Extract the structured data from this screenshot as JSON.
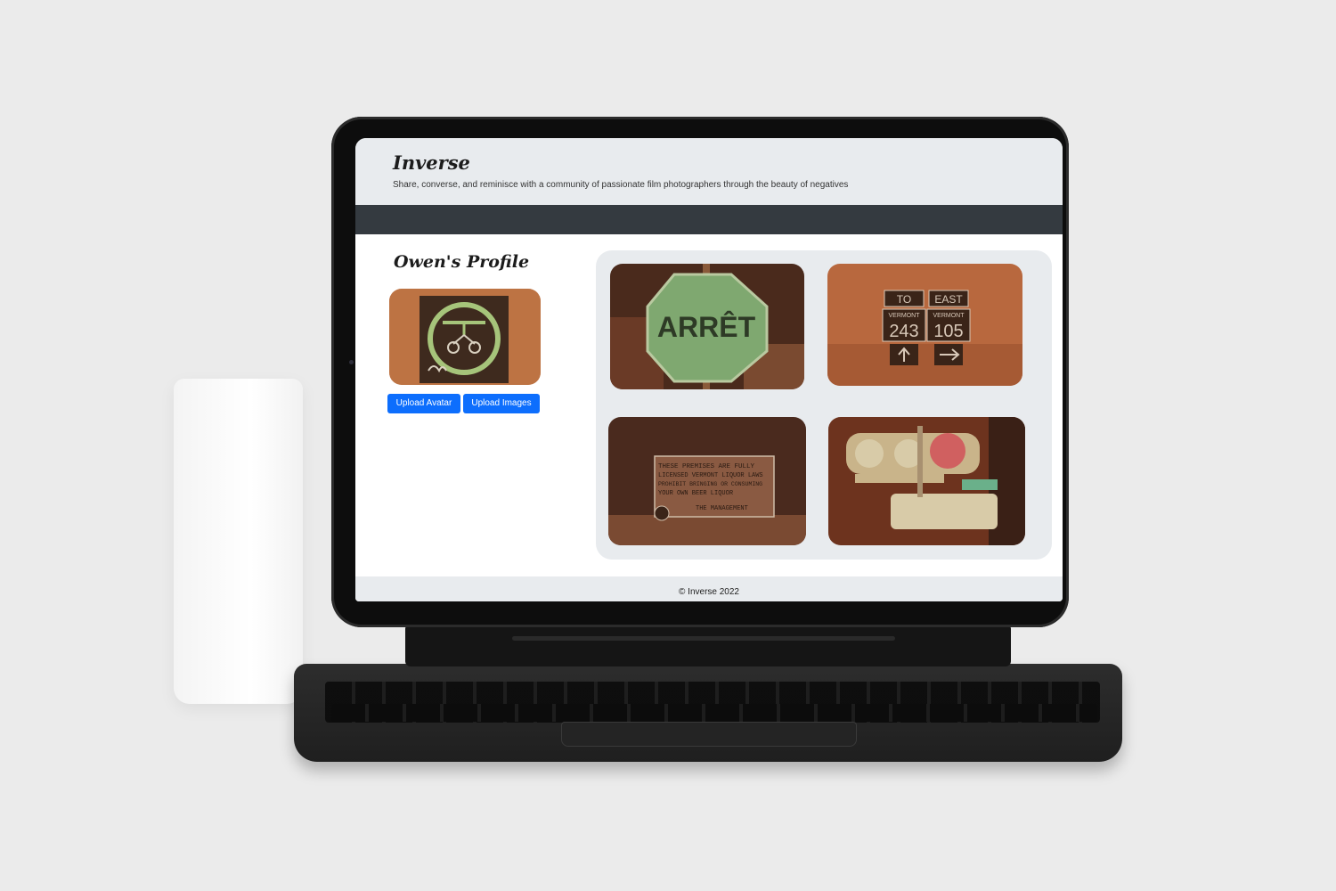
{
  "app": {
    "brand": "Inverse",
    "tagline": "Share, converse, and reminisce with a community of passionate film photographers through the beauty of negatives"
  },
  "profile": {
    "title": "Owen's Profile",
    "avatar_icon": "stop-sign-negative-photo",
    "buttons": {
      "upload_avatar": "Upload Avatar",
      "upload_images": "Upload Images"
    }
  },
  "gallery": {
    "photos": [
      {
        "icon": "stop-sign-photo",
        "text": "ARRÊT"
      },
      {
        "icon": "road-sign-photo",
        "to": "TO",
        "east": "EAST",
        "vermont_left": "VERMONT",
        "vermont_right": "VERMONT",
        "route_left": "243",
        "route_right": "105"
      },
      {
        "icon": "notice-sign-photo",
        "lines": [
          "THESE PREMISES ARE FULLY",
          "LICENSED VERMONT LIQUOR LAWS",
          "PROHIBIT BRINGING OR CONSUMING",
          "YOUR OWN BEER LIQUOR",
          "THE MANAGEMENT"
        ]
      },
      {
        "icon": "traffic-light-photo"
      }
    ]
  },
  "footer": {
    "text": "© Inverse 2022"
  },
  "colors": {
    "accent": "#0d6efd",
    "navbar": "#343a40",
    "header_bg": "#e8ebee",
    "photo_tint": "#8a4a2e"
  }
}
